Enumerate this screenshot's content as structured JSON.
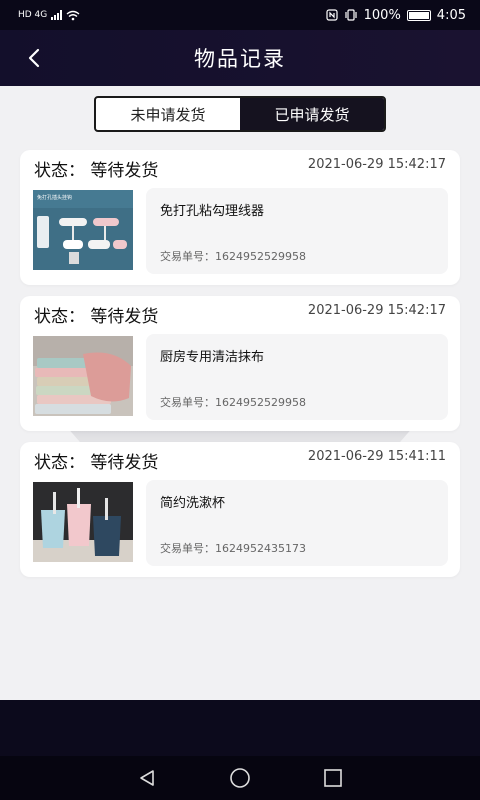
{
  "status_bar": {
    "left": "HD 4G",
    "right_text": "100%",
    "time": "4:05"
  },
  "header": {
    "title": "物品记录"
  },
  "tabs": [
    {
      "label": "未申请发货",
      "active": false
    },
    {
      "label": "已申请发货",
      "active": true
    }
  ],
  "records": [
    {
      "status": "状态：  等待发货",
      "time": "2021-06-29 15:42:17",
      "name": "免打孔粘勾理线器",
      "order": "交易单号：1624952529958",
      "thumb_text": "免打孔插头挂钩"
    },
    {
      "status": "状态：  等待发货",
      "time": "2021-06-29 15:42:17",
      "name": "厨房专用清洁抹布",
      "order": "交易单号：1624952529958"
    },
    {
      "status": "状态：  等待发货",
      "time": "2021-06-29 15:41:11",
      "name": "简约洗漱杯",
      "order": "交易单号：1624952435173"
    }
  ],
  "colors": {
    "header_bg": "#130f2b",
    "content_bg": "#f1f1f3",
    "active_tab_bg": "#15121f"
  }
}
